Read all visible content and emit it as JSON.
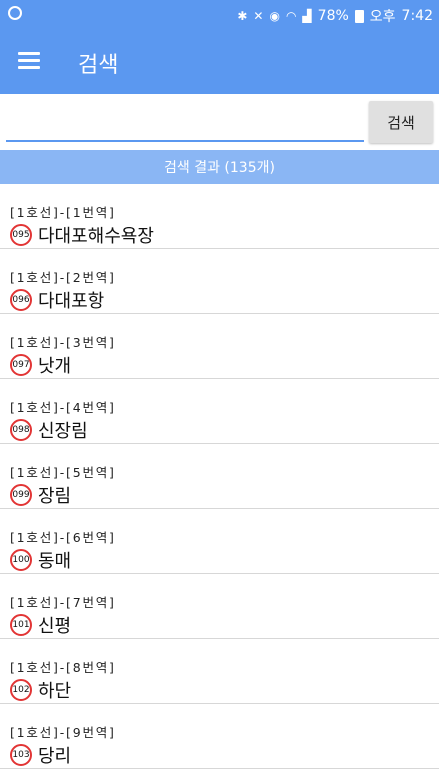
{
  "status_bar": {
    "battery": "78%",
    "ampm": "오후",
    "time": "7:42"
  },
  "app_bar": {
    "title": "검색"
  },
  "search": {
    "value": "",
    "placeholder": "",
    "button_label": "검색"
  },
  "results": {
    "summary": "검색 결과 (135개)",
    "items": [
      {
        "meta": "[1호선]-[1번역]",
        "code": "095",
        "name": "다대포해수욕장"
      },
      {
        "meta": "[1호선]-[2번역]",
        "code": "096",
        "name": "다대포항"
      },
      {
        "meta": "[1호선]-[3번역]",
        "code": "097",
        "name": "낫개"
      },
      {
        "meta": "[1호선]-[4번역]",
        "code": "098",
        "name": "신장림"
      },
      {
        "meta": "[1호선]-[5번역]",
        "code": "099",
        "name": "장림"
      },
      {
        "meta": "[1호선]-[6번역]",
        "code": "100",
        "name": "동매"
      },
      {
        "meta": "[1호선]-[7번역]",
        "code": "101",
        "name": "신평"
      },
      {
        "meta": "[1호선]-[8번역]",
        "code": "102",
        "name": "하단"
      },
      {
        "meta": "[1호선]-[9번역]",
        "code": "103",
        "name": "당리"
      }
    ]
  },
  "colors": {
    "primary": "#5b98f0",
    "result_bar": "#8ab6f4",
    "badge_border": "#e23535"
  }
}
